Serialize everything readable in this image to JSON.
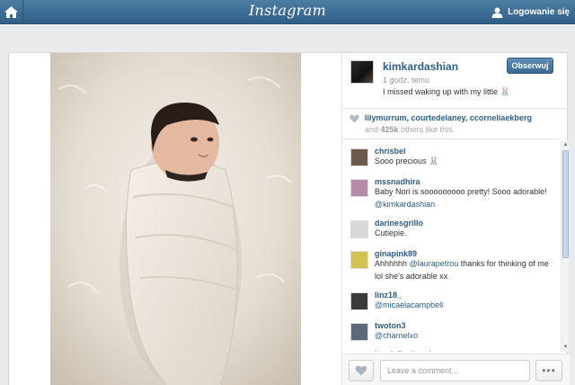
{
  "header": {
    "logo": "Instagram",
    "login_label": "Logowanie się",
    "home_icon": "home-icon",
    "user_icon": "user-icon"
  },
  "post": {
    "username": "kimkardashian",
    "time": "1 godz. temu",
    "caption": "I missed waking up with my little 🐰",
    "follow_label": "Obserwuj"
  },
  "likes": {
    "names": [
      "lilymurrum",
      "courtedelaney",
      "ccorneliaekberg"
    ],
    "count": "425k",
    "others_suffix": " others like this."
  },
  "comments": [
    {
      "user": "chrisbel",
      "parts": [
        {
          "t": "Sooo precious 🐰"
        }
      ],
      "avatar_color": "#6b5a4e"
    },
    {
      "user": "mssnadhira",
      "parts": [
        {
          "t": "Baby Nori is sooooooooo pretty! Sooo adorable!"
        },
        {
          "t": "@kimkardashian",
          "m": true
        }
      ],
      "avatar_color": "#b78aa9"
    },
    {
      "user": "darinesgrillo",
      "parts": [
        {
          "t": "Cutiepie."
        }
      ],
      "avatar_color": "#d8d8d8"
    },
    {
      "user": "ginapink89",
      "parts": [
        {
          "t": "Ahhhhhh "
        },
        {
          "t": "@laurapetrou",
          "m": true
        },
        {
          "t": " thanks for thinking of me lol she's adorable xx"
        }
      ],
      "avatar_color": "#d3c24f"
    },
    {
      "user": "linz18_",
      "parts": [
        {
          "t": "@micaelacampbell",
          "m": true
        }
      ],
      "avatar_color": "#3a3a3a"
    },
    {
      "user": "twoton3",
      "parts": [
        {
          "t": "@charnelxo",
          "m": true
        }
      ],
      "avatar_color": "#5c6a78"
    },
    {
      "user": "jessiefinejewelry",
      "parts": [
        {
          "t": ""
        }
      ],
      "avatar_color": "#7a7a7a"
    }
  ],
  "footer": {
    "comment_placeholder": "Leave a comment...",
    "more_label": "•••"
  },
  "colors": {
    "header_blue": "#3b6a92",
    "link_blue": "#2e5e86"
  }
}
